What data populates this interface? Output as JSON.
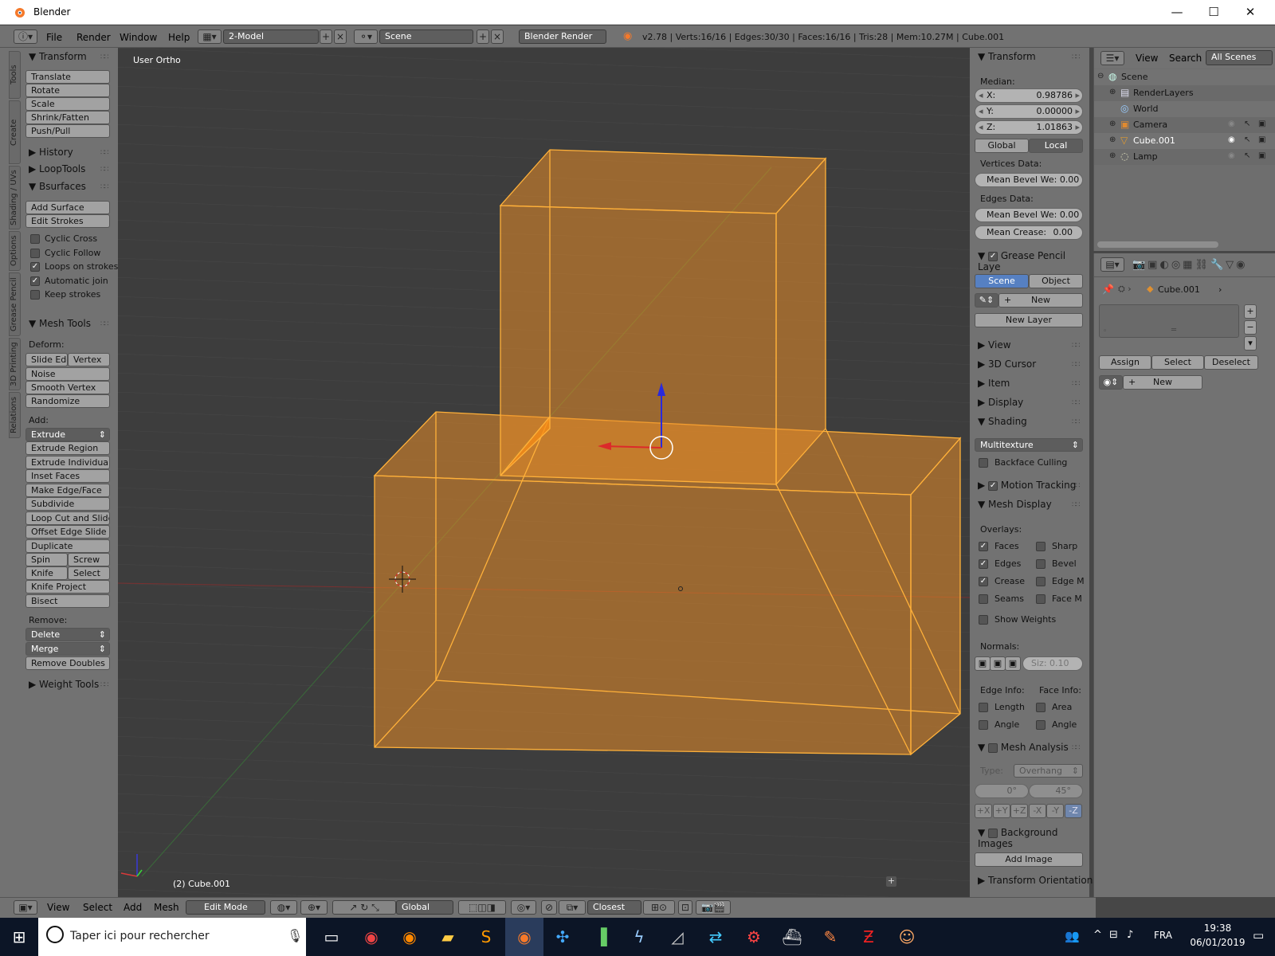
{
  "window": {
    "title": "Blender",
    "minimize": "—",
    "maximize": "☐",
    "close": "✕"
  },
  "menus": [
    "File",
    "Render",
    "Window",
    "Help"
  ],
  "screen_layout": "2-Model",
  "scene_name": "Scene",
  "render_engine": "Blender Render",
  "status": "v2.78 | Verts:16/16 | Edges:30/30 | Faces:16/16 | Tris:28 | Mem:10.27M | Cube.001",
  "tool_tabs": [
    "Tools",
    "Create",
    "Shading / UVs",
    "Options",
    "Grease Pencil",
    "3D Printing",
    "Relations"
  ],
  "toolshelf": {
    "transform": {
      "header": "Transform",
      "buttons": [
        "Translate",
        "Rotate",
        "Scale",
        "Shrink/Fatten",
        "Push/Pull"
      ]
    },
    "history": "History",
    "looptools": "LoopTools",
    "bsurfaces": {
      "header": "Bsurfaces",
      "buttons": [
        "Add Surface",
        "Edit Strokes"
      ],
      "checks": [
        {
          "label": "Cyclic Cross",
          "checked": false
        },
        {
          "label": "Cyclic Follow",
          "checked": false
        },
        {
          "label": "Loops on strokes",
          "checked": true
        },
        {
          "label": "Automatic join",
          "checked": true
        },
        {
          "label": "Keep strokes",
          "checked": false
        }
      ]
    },
    "mesh_tools": {
      "header": "Mesh Tools",
      "deform_label": "Deform:",
      "slide_edge": "Slide Edg",
      "vertex": "Vertex",
      "noise": "Noise",
      "smooth_vertex": "Smooth Vertex",
      "randomize": "Randomize",
      "add_label": "Add:",
      "extrude": "Extrude",
      "add_buttons": [
        "Extrude Region",
        "Extrude Individual",
        "Inset Faces",
        "Make Edge/Face",
        "Subdivide",
        "Loop Cut and Slide",
        "Offset Edge Slide",
        "Duplicate"
      ],
      "spin": "Spin",
      "screw": "Screw",
      "knife": "Knife",
      "select": "Select",
      "knife_project": "Knife Project",
      "bisect": "Bisect",
      "remove_label": "Remove:",
      "delete": "Delete",
      "merge": "Merge",
      "remove_doubles": "Remove Doubles"
    },
    "weight_tools": "Weight Tools"
  },
  "viewport": {
    "view_name": "User Ortho",
    "object_info": "(2) Cube.001"
  },
  "properties": {
    "transform": {
      "header": "Transform",
      "median": "Median:",
      "x_label": "X:",
      "x": "0.98786",
      "y_label": "Y:",
      "y": "0.00000",
      "z_label": "Z:",
      "z": "1.01863",
      "global": "Global",
      "local": "Local",
      "vertices_data": "Vertices Data:",
      "mean_bevel_v": "Mean Bevel We: 0.00",
      "edges_data": "Edges Data:",
      "mean_bevel_e": "Mean Bevel We: 0.00",
      "mean_crease_label": "Mean Crease:",
      "mean_crease": "0.00"
    },
    "grease_pencil": {
      "header": "Grease Pencil Laye",
      "scene": "Scene",
      "object": "Object",
      "new": "New",
      "new_layer": "New Layer"
    },
    "collapsed": [
      "View",
      "3D Cursor",
      "Item",
      "Display"
    ],
    "shading": {
      "header": "Shading",
      "mode": "Multitexture",
      "backface": "Backface Culling"
    },
    "motion_tracking": "Motion Tracking",
    "mesh_display": {
      "header": "Mesh Display",
      "overlays": "Overlays:",
      "left": [
        {
          "label": "Faces",
          "checked": true
        },
        {
          "label": "Edges",
          "checked": true
        },
        {
          "label": "Crease",
          "checked": true
        },
        {
          "label": "Seams",
          "checked": false
        }
      ],
      "right": [
        {
          "label": "Sharp",
          "checked": false
        },
        {
          "label": "Bevel",
          "checked": false
        },
        {
          "label": "Edge M",
          "checked": false
        },
        {
          "label": "Face M",
          "checked": false
        }
      ],
      "show_weights": "Show Weights",
      "normals": "Normals:",
      "size": "Siz: 0.10",
      "edge_info": "Edge Info:",
      "face_info": "Face Info:",
      "length": "Length",
      "area": "Area",
      "angle_e": "Angle",
      "angle_f": "Angle"
    },
    "mesh_analysis": {
      "header": "Mesh Analysis",
      "type_label": "Type:",
      "type": "Overhang",
      "min": "0°",
      "max": "45°",
      "axes": [
        "+X",
        "+Y",
        "+Z",
        "-X",
        "-Y",
        "-Z"
      ]
    },
    "background_images": {
      "header": "Background Images",
      "add_image": "Add Image"
    },
    "transform_orientations": "Transform Orientations"
  },
  "outliner": {
    "view": "View",
    "search": "Search",
    "all_scenes": "All Scenes",
    "items": [
      {
        "name": "Scene",
        "level": 0
      },
      {
        "name": "RenderLayers",
        "level": 1
      },
      {
        "name": "World",
        "level": 1
      },
      {
        "name": "Camera",
        "level": 1
      },
      {
        "name": "Cube.001",
        "level": 1
      },
      {
        "name": "Lamp",
        "level": 1
      }
    ]
  },
  "material": {
    "object": "Cube.001",
    "assign": "Assign",
    "select": "Select",
    "deselect": "Deselect",
    "new": "New"
  },
  "bottom": {
    "view": "View",
    "select": "Select",
    "add": "Add",
    "mesh": "Mesh",
    "mode": "Edit Mode",
    "orientation": "Global",
    "snap": "Closest"
  },
  "taskbar": {
    "search": "Taper ici pour rechercher",
    "lang": "FRA",
    "time": "19:38",
    "date": "06/01/2019"
  },
  "colors": {
    "selection": "#f5a623",
    "ui_bg": "#727272",
    "viewport_bg": "#3d3d3d",
    "accent": "#5680c2"
  }
}
